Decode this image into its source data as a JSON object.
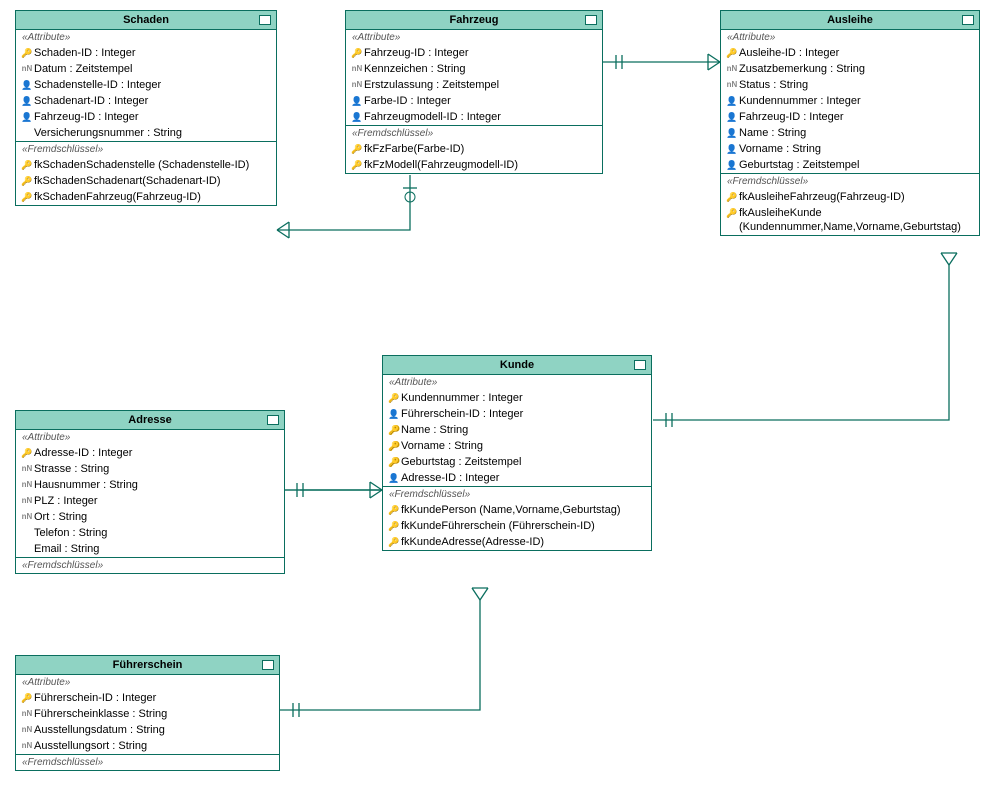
{
  "stereotypes": {
    "attribute": "«Attribute»",
    "fk": "«Fremdschlüssel»"
  },
  "entities": {
    "schaden": {
      "title": "Schaden",
      "attrs": [
        {
          "icon": "pk",
          "text": "Schaden-ID : Integer"
        },
        {
          "icon": "nn",
          "text": "Datum : Zeitstempel"
        },
        {
          "icon": "fk-attr",
          "text": "Schadenstelle-ID : Integer"
        },
        {
          "icon": "fk-attr",
          "text": "Schadenart-ID : Integer"
        },
        {
          "icon": "fk-attr",
          "text": "Fahrzeug-ID : Integer"
        },
        {
          "icon": "",
          "text": "Versicherungsnummer : String"
        }
      ],
      "fks": [
        {
          "text": "fkSchadenSchadenstelle (Schadenstelle-ID)"
        },
        {
          "text": "fkSchadenSchadenart(Schadenart-ID)"
        },
        {
          "text": "fkSchadenFahrzeug(Fahrzeug-ID)"
        }
      ]
    },
    "fahrzeug": {
      "title": "Fahrzeug",
      "attrs": [
        {
          "icon": "pk",
          "text": "Fahrzeug-ID : Integer"
        },
        {
          "icon": "nn",
          "text": "Kennzeichen : String"
        },
        {
          "icon": "nn",
          "text": "Erstzulassung : Zeitstempel"
        },
        {
          "icon": "fk-attr",
          "text": "Farbe-ID : Integer"
        },
        {
          "icon": "fk-attr",
          "text": "Fahrzeugmodell-ID : Integer"
        }
      ],
      "fks": [
        {
          "text": "fkFzFarbe(Farbe-ID)"
        },
        {
          "text": "fkFzModell(Fahrzeugmodell-ID)"
        }
      ]
    },
    "ausleihe": {
      "title": "Ausleihe",
      "attrs": [
        {
          "icon": "pk",
          "text": "Ausleihe-ID : Integer"
        },
        {
          "icon": "nn",
          "text": "Zusatzbemerkung : String"
        },
        {
          "icon": "nn",
          "text": "Status : String"
        },
        {
          "icon": "fk-attr",
          "text": "Kundennummer : Integer"
        },
        {
          "icon": "fk-attr",
          "text": "Fahrzeug-ID : Integer"
        },
        {
          "icon": "fk-attr",
          "text": "Name : String"
        },
        {
          "icon": "fk-attr",
          "text": "Vorname : String"
        },
        {
          "icon": "fk-attr",
          "text": "Geburtstag : Zeitstempel"
        }
      ],
      "fks": [
        {
          "text": "fkAusleiheFahrzeug(Fahrzeug-ID)"
        },
        {
          "text": "fkAusleiheKunde (Kundennummer,Name,Vorname,Geburtstag)"
        }
      ]
    },
    "kunde": {
      "title": "Kunde",
      "attrs": [
        {
          "icon": "pk",
          "text": "Kundennummer : Integer"
        },
        {
          "icon": "fk-attr",
          "text": "Führerschein-ID : Integer"
        },
        {
          "icon": "pk-double",
          "text": "Name : String"
        },
        {
          "icon": "pk-double",
          "text": "Vorname : String"
        },
        {
          "icon": "pk-double",
          "text": "Geburtstag : Zeitstempel"
        },
        {
          "icon": "fk-attr",
          "text": "Adresse-ID : Integer"
        }
      ],
      "fks": [
        {
          "text": "fkKundePerson (Name,Vorname,Geburtstag)"
        },
        {
          "text": "fkKundeFührerschein (Führerschein-ID)"
        },
        {
          "text": "fkKundeAdresse(Adresse-ID)"
        }
      ]
    },
    "adresse": {
      "title": "Adresse",
      "attrs": [
        {
          "icon": "pk",
          "text": "Adresse-ID : Integer"
        },
        {
          "icon": "nn",
          "text": "Strasse : String"
        },
        {
          "icon": "nn",
          "text": "Hausnummer : String"
        },
        {
          "icon": "nn",
          "text": "PLZ : Integer"
        },
        {
          "icon": "nn",
          "text": "Ort : String"
        },
        {
          "icon": "",
          "text": "Telefon : String"
        },
        {
          "icon": "",
          "text": "Email : String"
        }
      ],
      "fks": []
    },
    "fuehrerschein": {
      "title": "Führerschein",
      "attrs": [
        {
          "icon": "pk",
          "text": "Führerschein-ID : Integer"
        },
        {
          "icon": "nn",
          "text": "Führerscheinklasse : String"
        },
        {
          "icon": "nn",
          "text": "Ausstellungsdatum : String"
        },
        {
          "icon": "nn",
          "text": "Ausstellungsort : String"
        }
      ],
      "fks": []
    }
  }
}
